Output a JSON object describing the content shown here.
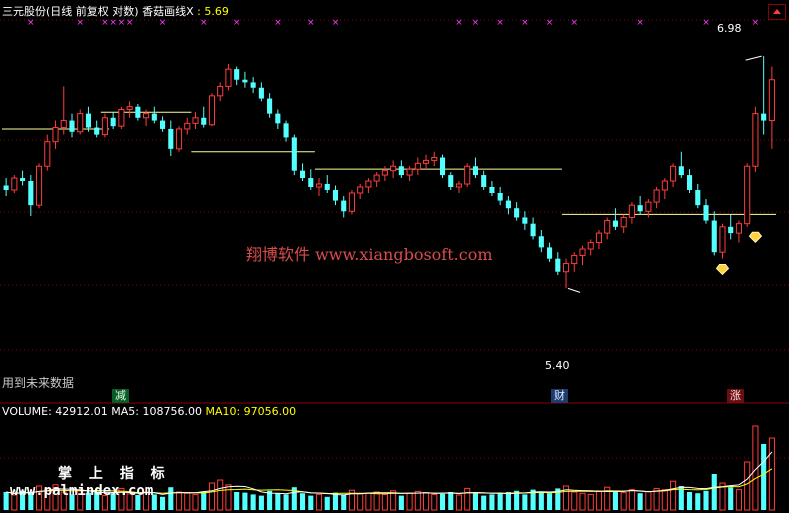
{
  "header": {
    "stock_name": "三元股份(日线 前复权 对数)",
    "indicator_label": "香菇画线X",
    "indicator_value": ": 5.69"
  },
  "price_labels": {
    "high": "6.98",
    "low": "5.40"
  },
  "note_future_data": "用到未来数据",
  "signal_tags": {
    "jian": "减",
    "cai": "财",
    "zhang": "涨"
  },
  "volume_header": {
    "volume": "VOLUME: 42912.01",
    "ma5": "MA5: 108756.00",
    "ma10": "MA10: 97056.00"
  },
  "watermarks": {
    "xiangbo": "翔博软件 www.xiangbosoft.com",
    "zhangshang": "掌 上 指 标",
    "palmindex": "www.palmindex.com"
  },
  "colors": {
    "up": "#ff3c3c",
    "down": "#54ffff",
    "hline": "#ffff96",
    "marker": "#ff3cff",
    "grid": "#8b0000",
    "ma5": "#ffffff",
    "ma10": "#ffff00"
  },
  "chart_data": {
    "type": "candlestick",
    "price_scale": "log",
    "price_range": [
      5.0,
      7.2
    ],
    "candles": [
      [
        6.05,
        6.1,
        5.98,
        6.02
      ],
      [
        6.02,
        6.12,
        6.0,
        6.1
      ],
      [
        6.1,
        6.15,
        6.05,
        6.08
      ],
      [
        6.08,
        6.12,
        5.85,
        5.92
      ],
      [
        5.92,
        6.2,
        5.9,
        6.18
      ],
      [
        6.18,
        6.4,
        6.15,
        6.35
      ],
      [
        6.35,
        6.5,
        6.3,
        6.45
      ],
      [
        6.45,
        6.75,
        6.4,
        6.5
      ],
      [
        6.5,
        6.55,
        6.38,
        6.42
      ],
      [
        6.42,
        6.58,
        6.4,
        6.55
      ],
      [
        6.55,
        6.6,
        6.42,
        6.45
      ],
      [
        6.45,
        6.5,
        6.38,
        6.4
      ],
      [
        6.4,
        6.55,
        6.38,
        6.52
      ],
      [
        6.52,
        6.56,
        6.44,
        6.46
      ],
      [
        6.46,
        6.6,
        6.44,
        6.58
      ],
      [
        6.58,
        6.64,
        6.52,
        6.6
      ],
      [
        6.6,
        6.62,
        6.5,
        6.52
      ],
      [
        6.52,
        6.58,
        6.46,
        6.55
      ],
      [
        6.55,
        6.6,
        6.48,
        6.5
      ],
      [
        6.5,
        6.53,
        6.42,
        6.44
      ],
      [
        6.44,
        6.5,
        6.25,
        6.3
      ],
      [
        6.3,
        6.46,
        6.28,
        6.44
      ],
      [
        6.44,
        6.52,
        6.4,
        6.48
      ],
      [
        6.48,
        6.56,
        6.44,
        6.52
      ],
      [
        6.52,
        6.6,
        6.45,
        6.47
      ],
      [
        6.47,
        6.7,
        6.46,
        6.68
      ],
      [
        6.68,
        6.78,
        6.64,
        6.75
      ],
      [
        6.75,
        6.92,
        6.72,
        6.88
      ],
      [
        6.88,
        6.9,
        6.76,
        6.8
      ],
      [
        6.8,
        6.86,
        6.74,
        6.78
      ],
      [
        6.78,
        6.82,
        6.7,
        6.74
      ],
      [
        6.74,
        6.78,
        6.64,
        6.66
      ],
      [
        6.66,
        6.7,
        6.52,
        6.55
      ],
      [
        6.55,
        6.58,
        6.44,
        6.48
      ],
      [
        6.48,
        6.5,
        6.35,
        6.38
      ],
      [
        6.38,
        6.4,
        6.12,
        6.15
      ],
      [
        6.15,
        6.2,
        6.08,
        6.1
      ],
      [
        6.1,
        6.16,
        6.02,
        6.04
      ],
      [
        6.04,
        6.1,
        5.98,
        6.06
      ],
      [
        6.06,
        6.12,
        6.0,
        6.02
      ],
      [
        6.02,
        6.05,
        5.92,
        5.95
      ],
      [
        5.95,
        5.98,
        5.84,
        5.88
      ],
      [
        5.88,
        6.02,
        5.86,
        6.0
      ],
      [
        6.0,
        6.06,
        5.96,
        6.04
      ],
      [
        6.04,
        6.1,
        6.0,
        6.08
      ],
      [
        6.08,
        6.14,
        6.04,
        6.12
      ],
      [
        6.12,
        6.18,
        6.08,
        6.15
      ],
      [
        6.15,
        6.22,
        6.1,
        6.18
      ],
      [
        6.18,
        6.22,
        6.1,
        6.12
      ],
      [
        6.12,
        6.18,
        6.08,
        6.16
      ],
      [
        6.16,
        6.24,
        6.12,
        6.2
      ],
      [
        6.2,
        6.26,
        6.16,
        6.22
      ],
      [
        6.22,
        6.28,
        6.18,
        6.24
      ],
      [
        6.24,
        6.26,
        6.1,
        6.12
      ],
      [
        6.12,
        6.14,
        6.02,
        6.04
      ],
      [
        6.04,
        6.08,
        6.0,
        6.06
      ],
      [
        6.06,
        6.2,
        6.04,
        6.18
      ],
      [
        6.18,
        6.24,
        6.1,
        6.12
      ],
      [
        6.12,
        6.15,
        6.02,
        6.04
      ],
      [
        6.04,
        6.08,
        5.98,
        6.0
      ],
      [
        6.0,
        6.04,
        5.92,
        5.95
      ],
      [
        5.95,
        5.98,
        5.86,
        5.9
      ],
      [
        5.9,
        5.94,
        5.82,
        5.84
      ],
      [
        5.84,
        5.88,
        5.76,
        5.8
      ],
      [
        5.8,
        5.84,
        5.7,
        5.72
      ],
      [
        5.72,
        5.76,
        5.62,
        5.65
      ],
      [
        5.65,
        5.68,
        5.56,
        5.58
      ],
      [
        5.58,
        5.62,
        5.48,
        5.5
      ],
      [
        5.5,
        5.58,
        5.4,
        5.55
      ],
      [
        5.55,
        5.62,
        5.5,
        5.6
      ],
      [
        5.6,
        5.66,
        5.54,
        5.64
      ],
      [
        5.64,
        5.7,
        5.6,
        5.68
      ],
      [
        5.68,
        5.76,
        5.64,
        5.74
      ],
      [
        5.74,
        5.84,
        5.7,
        5.82
      ],
      [
        5.82,
        5.9,
        5.76,
        5.78
      ],
      [
        5.78,
        5.86,
        5.74,
        5.84
      ],
      [
        5.84,
        5.94,
        5.8,
        5.92
      ],
      [
        5.92,
        5.98,
        5.86,
        5.88
      ],
      [
        5.88,
        5.96,
        5.84,
        5.94
      ],
      [
        5.94,
        6.04,
        5.9,
        6.02
      ],
      [
        6.02,
        6.1,
        5.96,
        6.08
      ],
      [
        6.08,
        6.2,
        6.04,
        6.18
      ],
      [
        6.18,
        6.28,
        6.1,
        6.12
      ],
      [
        6.12,
        6.16,
        6.0,
        6.02
      ],
      [
        6.02,
        6.06,
        5.9,
        5.92
      ],
      [
        5.92,
        5.96,
        5.8,
        5.82
      ],
      [
        5.82,
        5.88,
        5.6,
        5.62
      ],
      [
        5.62,
        5.8,
        5.58,
        5.78
      ],
      [
        5.78,
        5.86,
        5.7,
        5.74
      ],
      [
        5.74,
        5.82,
        5.68,
        5.8
      ],
      [
        5.8,
        6.2,
        5.78,
        6.18
      ],
      [
        6.18,
        6.6,
        6.14,
        6.55
      ],
      [
        6.55,
        6.98,
        6.4,
        6.5
      ],
      [
        6.5,
        6.9,
        6.3,
        6.8
      ]
    ],
    "volumes": [
      3.0,
      2.5,
      3.2,
      2.8,
      4.0,
      3.5,
      4.2,
      3.0,
      2.6,
      3.4,
      2.9,
      3.1,
      2.4,
      2.8,
      3.6,
      2.7,
      2.5,
      3.0,
      2.6,
      2.2,
      3.8,
      3.0,
      2.8,
      2.6,
      3.1,
      4.5,
      5.0,
      4.2,
      3.0,
      2.9,
      2.6,
      2.4,
      3.2,
      2.8,
      2.6,
      3.8,
      2.8,
      2.4,
      2.6,
      2.2,
      2.9,
      2.5,
      3.3,
      2.7,
      2.8,
      3.0,
      2.6,
      3.2,
      2.4,
      2.8,
      3.1,
      2.9,
      2.6,
      2.7,
      3.0,
      2.5,
      3.6,
      2.8,
      2.4,
      2.6,
      2.8,
      3.0,
      3.2,
      2.6,
      3.4,
      3.0,
      2.8,
      3.6,
      4.0,
      3.0,
      2.8,
      2.6,
      3.2,
      3.8,
      3.0,
      2.9,
      3.4,
      2.8,
      3.1,
      3.6,
      3.4,
      4.8,
      4.0,
      3.0,
      2.8,
      3.2,
      6.0,
      4.5,
      3.8,
      3.4,
      8.0,
      14.0,
      11.0,
      12.0
    ],
    "volume_range": [
      0,
      15
    ],
    "horizontal_lines": [
      {
        "price": 6.44,
        "from": 0,
        "to": 12
      },
      {
        "price": 6.56,
        "from": 12,
        "to": 22
      },
      {
        "price": 6.28,
        "from": 23,
        "to": 37
      },
      {
        "price": 6.16,
        "from": 38,
        "to": 67
      },
      {
        "price": 5.86,
        "from": 68,
        "to": 93
      }
    ],
    "top_markers": [
      3,
      9,
      12,
      13,
      14,
      15,
      19,
      24,
      28,
      33,
      37,
      40,
      55,
      57,
      60,
      63,
      66,
      69,
      77,
      85,
      91
    ],
    "diamonds": [
      {
        "index": 87,
        "price": 5.52
      },
      {
        "index": 91,
        "price": 5.72
      }
    ]
  }
}
